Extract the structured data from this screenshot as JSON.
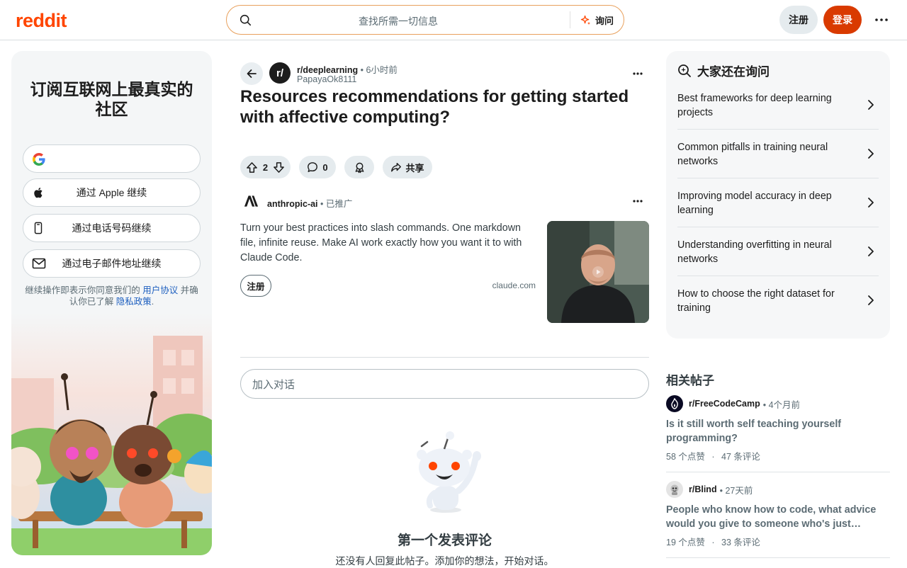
{
  "header": {
    "logo": "reddit",
    "search_placeholder": "查找所需一切信息",
    "ask_label": "询问",
    "signup_label": "注册",
    "login_label": "登录"
  },
  "promo": {
    "heading": "订阅互联网上最真实的社区",
    "apple_label": "通过 Apple 继续",
    "phone_label": "通过电话号码继续",
    "email_label": "通过电子邮件地址继续",
    "terms_prefix": "继续操作即表示你同意我们的 ",
    "terms_link": "用户协议",
    "terms_mid": " 并确认你已了解 ",
    "privacy_link": "隐私政策",
    "terms_suffix": "."
  },
  "post": {
    "subreddit": "r/deeplearning",
    "time": "• 6小时前",
    "author": "PapayaOk8111",
    "title": "Resources recommendations for getting started with affective computing?",
    "votes": "2",
    "comments": "0",
    "share_label": "共享"
  },
  "ad": {
    "advertiser": "anthropic-ai",
    "promoted": "• 已推广",
    "body": "Turn your best practices into slash commands. One markdown file, infinite reuse. Make AI work exactly how you want it to with Claude Code.",
    "cta": "注册",
    "domain": "claude.com"
  },
  "comments": {
    "placeholder": "加入对话",
    "empty_heading": "第一个发表评论",
    "empty_sub": "还没有人回复此帖子。添加你的想法，开始对话。"
  },
  "ask_panel": {
    "heading": "大家还在询问",
    "items": [
      {
        "label": "Best frameworks for deep learning projects"
      },
      {
        "label": "Common pitfalls in training neural networks"
      },
      {
        "label": "Improving model accuracy in deep learning"
      },
      {
        "label": "Understanding overfitting in neural networks"
      },
      {
        "label": "How to choose the right dataset for training"
      }
    ]
  },
  "related": {
    "heading": "相关帖子",
    "posts": [
      {
        "subreddit": "r/FreeCodeCamp",
        "time": "• 4个月前",
        "title": "Is it still worth self teaching yourself programming?",
        "likes": "58 个点赞",
        "dot": "·",
        "comments": "47 条评论"
      },
      {
        "subreddit": "r/Blind",
        "time": "• 27天前",
        "title": "People who know how to code, what advice would you give to someone who's just…",
        "likes": "19 个点赞",
        "dot": "·",
        "comments": "33 条评论"
      }
    ]
  },
  "colors": {
    "brand": "#ff4500",
    "login_bg": "#d93a00",
    "link": "#1d5fbf"
  }
}
